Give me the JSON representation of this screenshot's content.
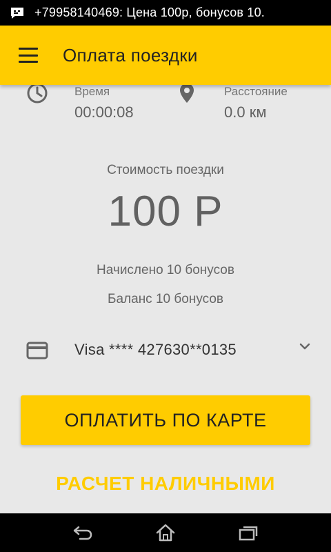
{
  "status_bar": {
    "notification_icon": "message-icon",
    "text": "+79958140469: Цена 100р, бонусов 10."
  },
  "app_bar": {
    "menu_icon": "hamburger-menu-icon",
    "title": "Оплата поездки"
  },
  "trip": {
    "time_label": "Время",
    "time_value": "00:00:08",
    "distance_label": "Расстояние",
    "distance_value": "0.0 км"
  },
  "cost": {
    "label": "Стоимость поездки",
    "value": "100 Р"
  },
  "bonuses": {
    "accrued": "Начислено 10 бонусов",
    "balance": "Баланс 10 бонусов"
  },
  "payment_method": {
    "icon": "credit-card-icon",
    "selected": "Visa **** 427630**0135"
  },
  "actions": {
    "pay_card": "ОПЛАТИТЬ ПО КАРТЕ",
    "pay_cash": "РАСЧЕТ НАЛИЧНЫМИ"
  },
  "colors": {
    "accent": "#FFCC00",
    "background": "#E8E8E8",
    "status_bar": "#000000"
  }
}
